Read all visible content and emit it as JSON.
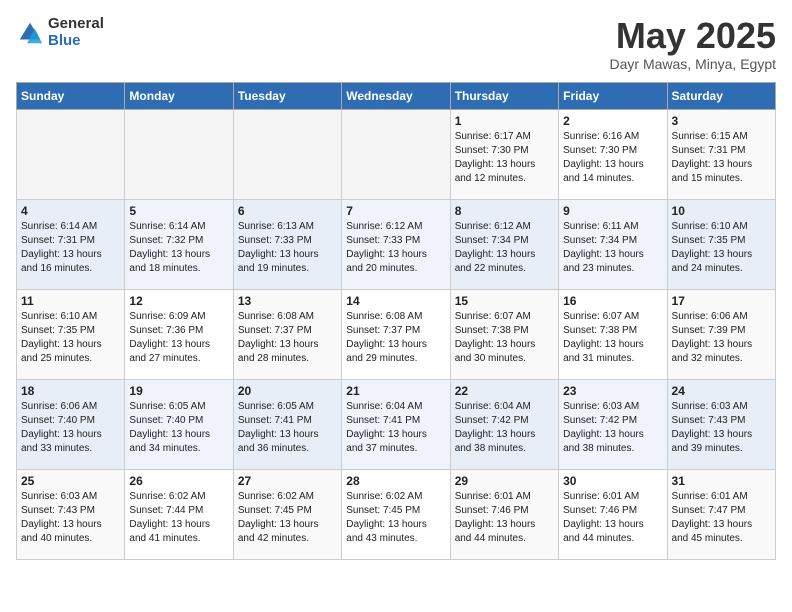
{
  "header": {
    "logo_general": "General",
    "logo_blue": "Blue",
    "month_title": "May 2025",
    "location": "Dayr Mawas, Minya, Egypt"
  },
  "days_of_week": [
    "Sunday",
    "Monday",
    "Tuesday",
    "Wednesday",
    "Thursday",
    "Friday",
    "Saturday"
  ],
  "weeks": [
    [
      {
        "day": "",
        "info": ""
      },
      {
        "day": "",
        "info": ""
      },
      {
        "day": "",
        "info": ""
      },
      {
        "day": "",
        "info": ""
      },
      {
        "day": "1",
        "info": "Sunrise: 6:17 AM\nSunset: 7:30 PM\nDaylight: 13 hours\nand 12 minutes."
      },
      {
        "day": "2",
        "info": "Sunrise: 6:16 AM\nSunset: 7:30 PM\nDaylight: 13 hours\nand 14 minutes."
      },
      {
        "day": "3",
        "info": "Sunrise: 6:15 AM\nSunset: 7:31 PM\nDaylight: 13 hours\nand 15 minutes."
      }
    ],
    [
      {
        "day": "4",
        "info": "Sunrise: 6:14 AM\nSunset: 7:31 PM\nDaylight: 13 hours\nand 16 minutes."
      },
      {
        "day": "5",
        "info": "Sunrise: 6:14 AM\nSunset: 7:32 PM\nDaylight: 13 hours\nand 18 minutes."
      },
      {
        "day": "6",
        "info": "Sunrise: 6:13 AM\nSunset: 7:33 PM\nDaylight: 13 hours\nand 19 minutes."
      },
      {
        "day": "7",
        "info": "Sunrise: 6:12 AM\nSunset: 7:33 PM\nDaylight: 13 hours\nand 20 minutes."
      },
      {
        "day": "8",
        "info": "Sunrise: 6:12 AM\nSunset: 7:34 PM\nDaylight: 13 hours\nand 22 minutes."
      },
      {
        "day": "9",
        "info": "Sunrise: 6:11 AM\nSunset: 7:34 PM\nDaylight: 13 hours\nand 23 minutes."
      },
      {
        "day": "10",
        "info": "Sunrise: 6:10 AM\nSunset: 7:35 PM\nDaylight: 13 hours\nand 24 minutes."
      }
    ],
    [
      {
        "day": "11",
        "info": "Sunrise: 6:10 AM\nSunset: 7:35 PM\nDaylight: 13 hours\nand 25 minutes."
      },
      {
        "day": "12",
        "info": "Sunrise: 6:09 AM\nSunset: 7:36 PM\nDaylight: 13 hours\nand 27 minutes."
      },
      {
        "day": "13",
        "info": "Sunrise: 6:08 AM\nSunset: 7:37 PM\nDaylight: 13 hours\nand 28 minutes."
      },
      {
        "day": "14",
        "info": "Sunrise: 6:08 AM\nSunset: 7:37 PM\nDaylight: 13 hours\nand 29 minutes."
      },
      {
        "day": "15",
        "info": "Sunrise: 6:07 AM\nSunset: 7:38 PM\nDaylight: 13 hours\nand 30 minutes."
      },
      {
        "day": "16",
        "info": "Sunrise: 6:07 AM\nSunset: 7:38 PM\nDaylight: 13 hours\nand 31 minutes."
      },
      {
        "day": "17",
        "info": "Sunrise: 6:06 AM\nSunset: 7:39 PM\nDaylight: 13 hours\nand 32 minutes."
      }
    ],
    [
      {
        "day": "18",
        "info": "Sunrise: 6:06 AM\nSunset: 7:40 PM\nDaylight: 13 hours\nand 33 minutes."
      },
      {
        "day": "19",
        "info": "Sunrise: 6:05 AM\nSunset: 7:40 PM\nDaylight: 13 hours\nand 34 minutes."
      },
      {
        "day": "20",
        "info": "Sunrise: 6:05 AM\nSunset: 7:41 PM\nDaylight: 13 hours\nand 36 minutes."
      },
      {
        "day": "21",
        "info": "Sunrise: 6:04 AM\nSunset: 7:41 PM\nDaylight: 13 hours\nand 37 minutes."
      },
      {
        "day": "22",
        "info": "Sunrise: 6:04 AM\nSunset: 7:42 PM\nDaylight: 13 hours\nand 38 minutes."
      },
      {
        "day": "23",
        "info": "Sunrise: 6:03 AM\nSunset: 7:42 PM\nDaylight: 13 hours\nand 38 minutes."
      },
      {
        "day": "24",
        "info": "Sunrise: 6:03 AM\nSunset: 7:43 PM\nDaylight: 13 hours\nand 39 minutes."
      }
    ],
    [
      {
        "day": "25",
        "info": "Sunrise: 6:03 AM\nSunset: 7:43 PM\nDaylight: 13 hours\nand 40 minutes."
      },
      {
        "day": "26",
        "info": "Sunrise: 6:02 AM\nSunset: 7:44 PM\nDaylight: 13 hours\nand 41 minutes."
      },
      {
        "day": "27",
        "info": "Sunrise: 6:02 AM\nSunset: 7:45 PM\nDaylight: 13 hours\nand 42 minutes."
      },
      {
        "day": "28",
        "info": "Sunrise: 6:02 AM\nSunset: 7:45 PM\nDaylight: 13 hours\nand 43 minutes."
      },
      {
        "day": "29",
        "info": "Sunrise: 6:01 AM\nSunset: 7:46 PM\nDaylight: 13 hours\nand 44 minutes."
      },
      {
        "day": "30",
        "info": "Sunrise: 6:01 AM\nSunset: 7:46 PM\nDaylight: 13 hours\nand 44 minutes."
      },
      {
        "day": "31",
        "info": "Sunrise: 6:01 AM\nSunset: 7:47 PM\nDaylight: 13 hours\nand 45 minutes."
      }
    ]
  ]
}
